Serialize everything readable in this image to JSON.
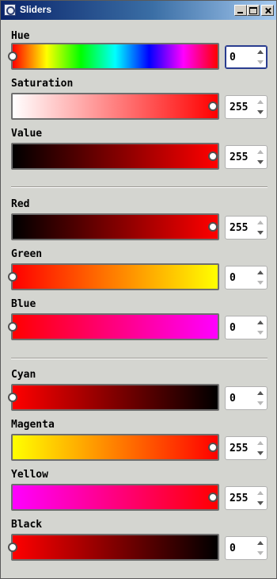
{
  "window": {
    "title": "Sliders"
  },
  "sliders": [
    {
      "label": "Hue",
      "value": "0",
      "level": 0,
      "gradient": "linear-gradient(to right,#ff0000 0%,#ffff00 16.6%,#00ff00 33.3%,#00ffff 50%,#0000ff 66.6%,#ff00ff 83.3%,#ff0000 100%)"
    },
    {
      "label": "Saturation",
      "value": "255",
      "level": 1,
      "gradient": "linear-gradient(to right,#ffffff,#ff0000)"
    },
    {
      "label": "Value",
      "value": "255",
      "level": 1,
      "gradient": "linear-gradient(to right,#000000,#ff0000)"
    },
    {
      "label": "Red",
      "value": "255",
      "level": 1,
      "gradient": "linear-gradient(to right,#000000,#ff0000)"
    },
    {
      "label": "Green",
      "value": "0",
      "level": 0,
      "gradient": "linear-gradient(to right,#ff0000,#ffff00)"
    },
    {
      "label": "Blue",
      "value": "0",
      "level": 0,
      "gradient": "linear-gradient(to right,#ff0000,#ff00ff)"
    },
    {
      "label": "Cyan",
      "value": "0",
      "level": 0,
      "gradient": "linear-gradient(to right,#ff0000,#000000)"
    },
    {
      "label": "Magenta",
      "value": "255",
      "level": 1,
      "gradient": "linear-gradient(to right,#ffff00,#ff0000)"
    },
    {
      "label": "Yellow",
      "value": "255",
      "level": 1,
      "gradient": "linear-gradient(to right,#ff00ff,#ff0000)"
    },
    {
      "label": "Black",
      "value": "0",
      "level": 0,
      "gradient": "linear-gradient(to right,#ff0000,#000000)"
    }
  ]
}
